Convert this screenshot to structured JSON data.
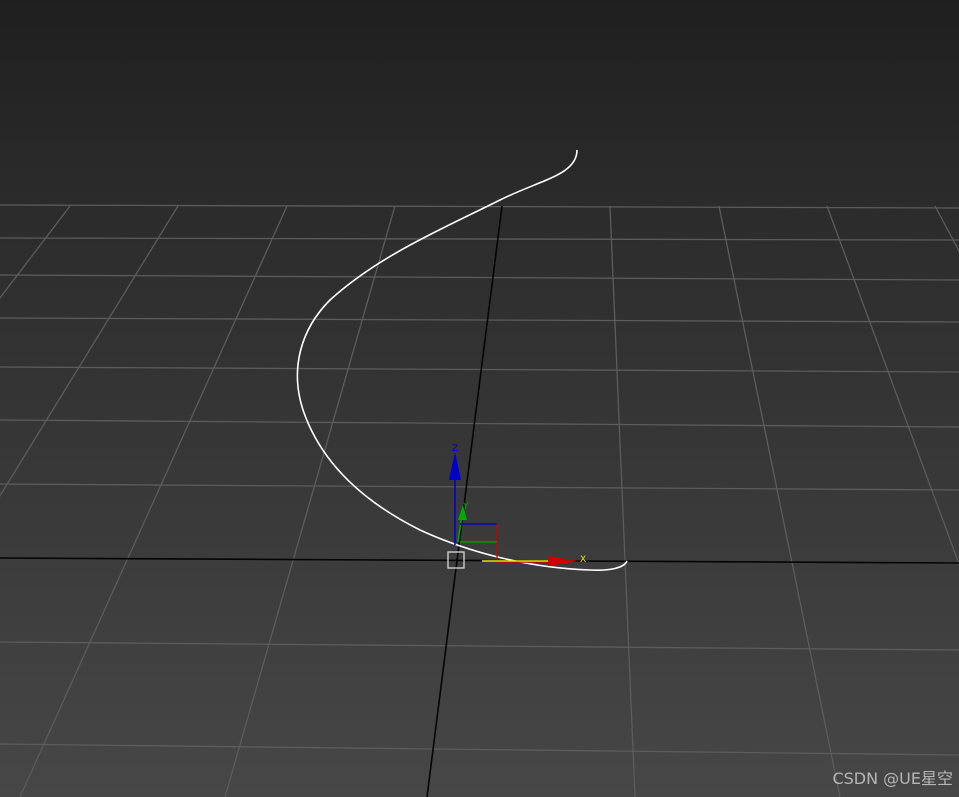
{
  "viewport": {
    "colors": {
      "background_top": "#1f1f1f",
      "background_horizon": "#2c2c2c",
      "background_bottom": "#474747",
      "grid_line": "#5c5c5c",
      "world_axis": "#050505",
      "curve": "#ffffff",
      "gizmo_x": "#cc0000",
      "gizmo_y": "#00aa00",
      "gizmo_z": "#0000cc",
      "gizmo_highlight": "#e6e600",
      "pivot_box": "#d9d9d9"
    },
    "gizmo": {
      "x_label": "X",
      "y_label": "Y",
      "z_label": "Z"
    }
  },
  "watermark": {
    "text": "CSDN @UE星空"
  }
}
